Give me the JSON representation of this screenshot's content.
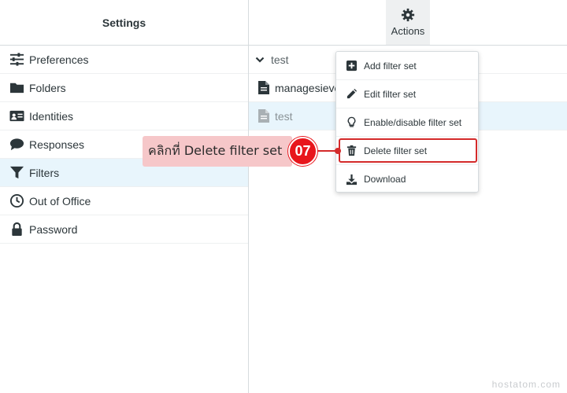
{
  "left_panel": {
    "title": "Settings",
    "items": [
      {
        "label": "Preferences",
        "icon": "sliders-icon"
      },
      {
        "label": "Folders",
        "icon": "folder-icon"
      },
      {
        "label": "Identities",
        "icon": "id-card-icon"
      },
      {
        "label": "Responses",
        "icon": "comment-icon"
      },
      {
        "label": "Filters",
        "icon": "filter-icon",
        "selected": true
      },
      {
        "label": "Out of Office",
        "icon": "clock-icon"
      },
      {
        "label": "Password",
        "icon": "lock-icon"
      }
    ]
  },
  "toolbar": {
    "actions_label": "Actions",
    "actions_icon": "gear-icon"
  },
  "filter_sets": {
    "group_label": "test",
    "items": [
      {
        "label": "managesieve",
        "icon": "file-icon"
      },
      {
        "label": "test",
        "icon": "file-icon",
        "selected": true
      }
    ]
  },
  "actions_menu": {
    "items": [
      {
        "label": "Add filter set",
        "icon": "plus-square-icon"
      },
      {
        "label": "Edit filter set",
        "icon": "pencil-icon"
      },
      {
        "label": "Enable/disable filter set",
        "icon": "lightbulb-icon"
      },
      {
        "label": "Delete filter set",
        "icon": "trash-icon",
        "highlighted": true
      },
      {
        "label": "Download",
        "icon": "download-icon"
      }
    ]
  },
  "annotation": {
    "step": "07",
    "text": "คลิกที่ Delete filter set",
    "accent_color": "#e8161c"
  },
  "watermark": "hostatom.com"
}
